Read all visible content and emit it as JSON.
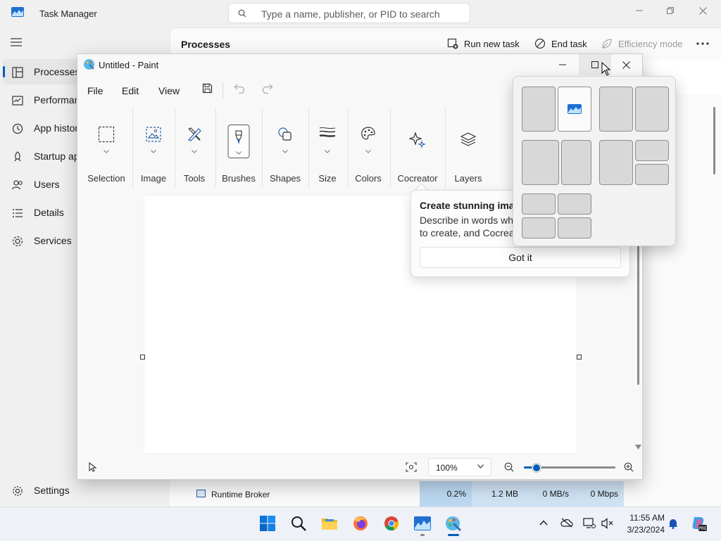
{
  "task_manager": {
    "title": "Task Manager",
    "search_placeholder": "Type a name, publisher, or PID to search",
    "nav": [
      {
        "label": "Processes",
        "icon": "processes-icon",
        "active": true
      },
      {
        "label": "Performance",
        "icon": "performance-icon"
      },
      {
        "label": "App history",
        "icon": "app-history-icon"
      },
      {
        "label": "Startup apps",
        "icon": "startup-apps-icon"
      },
      {
        "label": "Users",
        "icon": "users-icon"
      },
      {
        "label": "Details",
        "icon": "details-icon"
      },
      {
        "label": "Services",
        "icon": "services-icon"
      }
    ],
    "settings_label": "Settings",
    "heading": "Processes",
    "toolbar": {
      "run_new_task": "Run new task",
      "end_task": "End task",
      "efficiency_mode": "Efficiency mode"
    },
    "visible_row": {
      "name": "Runtime Broker",
      "cpu": "0.2%",
      "memory": "1.2 MB",
      "disk": "0 MB/s",
      "network": "0 Mbps"
    }
  },
  "paint": {
    "title": "Untitled - Paint",
    "menu": {
      "file": "File",
      "edit": "Edit",
      "view": "View"
    },
    "ribbon": [
      {
        "label": "Selection",
        "icon": "selection-icon",
        "dropdown": true
      },
      {
        "label": "Image",
        "icon": "image-icon",
        "dropdown": true
      },
      {
        "label": "Tools",
        "icon": "tools-icon",
        "dropdown": true
      },
      {
        "label": "Brushes",
        "icon": "brush-icon",
        "dropdown": true,
        "selected": true
      },
      {
        "label": "Shapes",
        "icon": "shapes-icon",
        "dropdown": true
      },
      {
        "label": "Size",
        "icon": "size-icon",
        "dropdown": true
      },
      {
        "label": "Colors",
        "icon": "palette-icon",
        "dropdown": true
      },
      {
        "label": "Cocreator",
        "icon": "cocreator-icon",
        "dropdown": false
      },
      {
        "label": "Layers",
        "icon": "layers-icon",
        "dropdown": false
      }
    ],
    "zoom": "100%",
    "zoom_slider_level": 0.1
  },
  "teaching_tip": {
    "title": "Create stunning imag",
    "body_line1": "Describe in words wh",
    "body_line2": "to create, and Cocrea",
    "button": "Got it"
  },
  "snap_layouts": {
    "layouts": [
      "two-columns",
      "two-columns-equal",
      "two-columns-split",
      "column-plus-two-rows",
      "four-quadrants"
    ]
  },
  "taskbar": {
    "items": [
      "start-icon",
      "search-icon",
      "file-explorer-icon",
      "firefox-icon",
      "chrome-icon",
      "task-manager-icon",
      "paint-icon"
    ],
    "time": "11:55 AM",
    "date": "3/23/2024"
  }
}
